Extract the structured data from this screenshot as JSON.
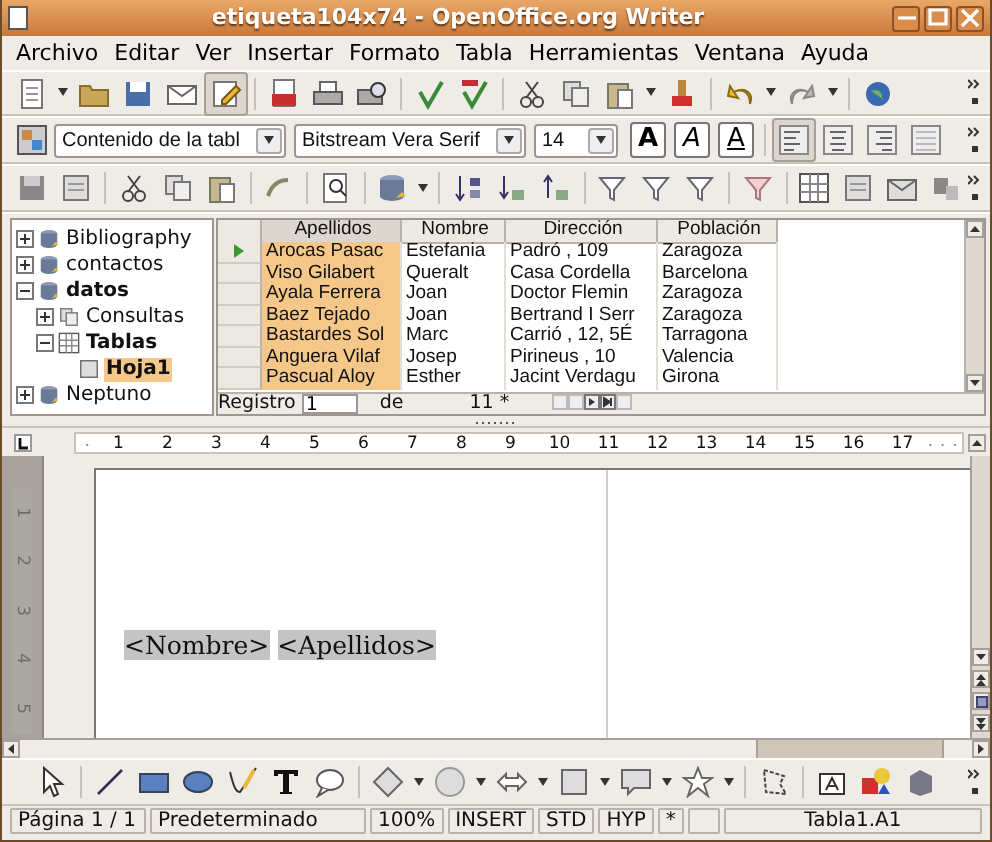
{
  "window": {
    "title": "etiqueta104x74 - OpenOffice.org Writer"
  },
  "menu": [
    "Archivo",
    "Editar",
    "Ver",
    "Insertar",
    "Formato",
    "Tabla",
    "Herramientas",
    "Ventana",
    "Ayuda"
  ],
  "standard_toolbar": {
    "edit_file": {
      "selected": true
    }
  },
  "format_toolbar": {
    "style": "Contenido de la tabl",
    "font": "Bitstream Vera Serif",
    "size": "14",
    "text_buttons": [
      {
        "label": "A",
        "kind": "bold"
      },
      {
        "label": "A",
        "kind": "italic"
      },
      {
        "label": "A",
        "kind": "underline"
      }
    ],
    "align_buttons": [
      {
        "selected": true
      },
      {
        "selected": false
      },
      {
        "selected": false
      },
      {
        "selected": false
      }
    ]
  },
  "tree": [
    {
      "label": "Bibliography",
      "kind": "database",
      "expanded": false,
      "active": false,
      "selected": false
    },
    {
      "label": "contactos",
      "kind": "database",
      "expanded": false,
      "active": false,
      "selected": false
    },
    {
      "label": "datos",
      "kind": "database",
      "expanded": true,
      "active": true,
      "selected": false,
      "children": [
        {
          "label": "Consultas",
          "kind": "queries",
          "expanded": false,
          "active": false,
          "selected": false
        },
        {
          "label": "Tablas",
          "kind": "tables",
          "expanded": true,
          "active": true,
          "selected": false,
          "children": [
            {
              "label": "Hoja1",
              "kind": "table",
              "active": true,
              "selected": true
            }
          ]
        }
      ]
    },
    {
      "label": "Neptuno",
      "kind": "database",
      "expanded": false,
      "active": false,
      "selected": false
    }
  ],
  "grid": {
    "columns": [
      {
        "label": "Apellidos",
        "selected": true
      },
      {
        "label": "Nombre",
        "selected": false
      },
      {
        "label": "Dirección",
        "selected": false
      },
      {
        "label": "Población",
        "selected": false
      }
    ],
    "rows": [
      {
        "current": true,
        "cells": [
          "Arocas Pasac",
          "Estefania",
          "Padró , 109",
          "Zaragoza"
        ]
      },
      {
        "current": false,
        "cells": [
          "Viso Gilabert",
          "Queralt",
          "Casa Cordella",
          "Barcelona"
        ]
      },
      {
        "current": false,
        "cells": [
          "Ayala Ferrera",
          "Joan",
          "Doctor Flemin",
          "Zaragoza"
        ]
      },
      {
        "current": false,
        "cells": [
          "Baez Tejado",
          "Joan",
          "Bertrand I Serr",
          "Zaragoza"
        ]
      },
      {
        "current": false,
        "cells": [
          "Bastardes Sol",
          "Marc",
          "Carrió , 12, 5É",
          "Tarragona"
        ]
      },
      {
        "current": false,
        "cells": [
          "Anguera Vilaf",
          "Josep",
          "Pirineus , 10",
          "Valencia"
        ]
      },
      {
        "current": false,
        "cells": [
          "Pascual Aloy",
          "Esther",
          "Jacint Verdagu",
          "Girona"
        ]
      }
    ],
    "record_label": "Registro",
    "record_value": "1",
    "of_label": "de",
    "record_count": "11 *"
  },
  "ruler": {
    "numbers": [
      "1",
      "2",
      "3",
      "4",
      "5",
      "6",
      "7",
      "8",
      "9",
      "10",
      "11",
      "12",
      "13",
      "14",
      "15",
      "16",
      "17"
    ]
  },
  "vertical_ruler": {
    "numbers": [
      "1",
      "2",
      "3",
      "4",
      "5"
    ]
  },
  "document": {
    "fields": [
      "<Nombre>",
      "<Apellidos>"
    ]
  },
  "status_bar": [
    "Página  1 / 1",
    "Predeterminado",
    "100%",
    "INSERT",
    "STD",
    "HYP",
    "*",
    "Tabla1.A1"
  ]
}
